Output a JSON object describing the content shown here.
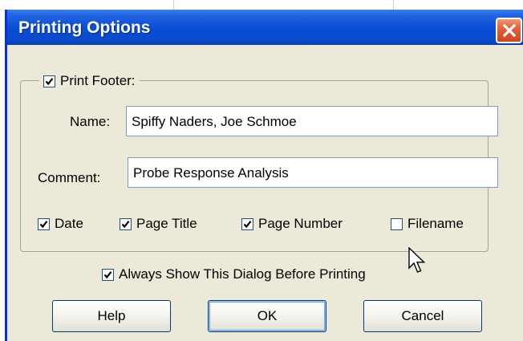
{
  "window": {
    "title": "Printing Options",
    "title_bar_color": "#0a4acb",
    "close_icon": "close-icon"
  },
  "footer_group": {
    "print_footer": {
      "label": "Print Footer:",
      "checked": true
    },
    "name": {
      "label": "Name:",
      "value": "Spiffy Naders, Joe Schmoe"
    },
    "comment": {
      "label": "Comment:",
      "value": "Probe Response Analysis"
    },
    "options": [
      {
        "label": "Date",
        "checked": true
      },
      {
        "label": "Page Title",
        "checked": true
      },
      {
        "label": "Page Number",
        "checked": true
      },
      {
        "label": "Filename",
        "checked": false
      }
    ]
  },
  "always_show": {
    "label": "Always Show This Dialog Before Printing",
    "checked": true
  },
  "buttons": {
    "help": "Help",
    "ok": "OK",
    "cancel": "Cancel"
  },
  "colors": {
    "dialog_bg": "#ece9d8",
    "close_button": "#e2613a",
    "field_border": "#7f9db9"
  }
}
